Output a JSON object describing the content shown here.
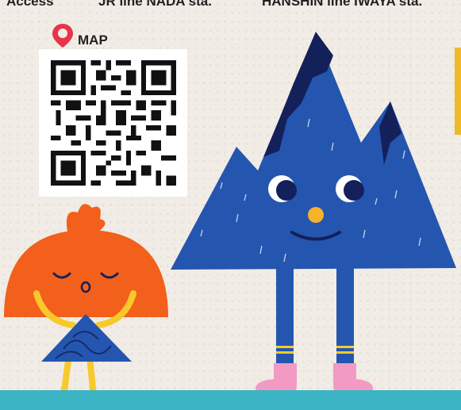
{
  "access": {
    "label": "Access",
    "line1": "JR line NADA sta.",
    "line2": "HANSHIN line IWAYA sta."
  },
  "map": {
    "label": "MAP",
    "pin_icon": "map-pin-icon",
    "qr_icon": "qr-code"
  },
  "colors": {
    "background": "#f1ece5",
    "mountain_blue": "#2456b0",
    "mountain_dark": "#14205a",
    "orange_character": "#f2601c",
    "yellow": "#f7c92a",
    "pink_boots": "#f29ac4",
    "pin_red": "#e8344a",
    "bottom_bar": "#3bb4c3"
  }
}
